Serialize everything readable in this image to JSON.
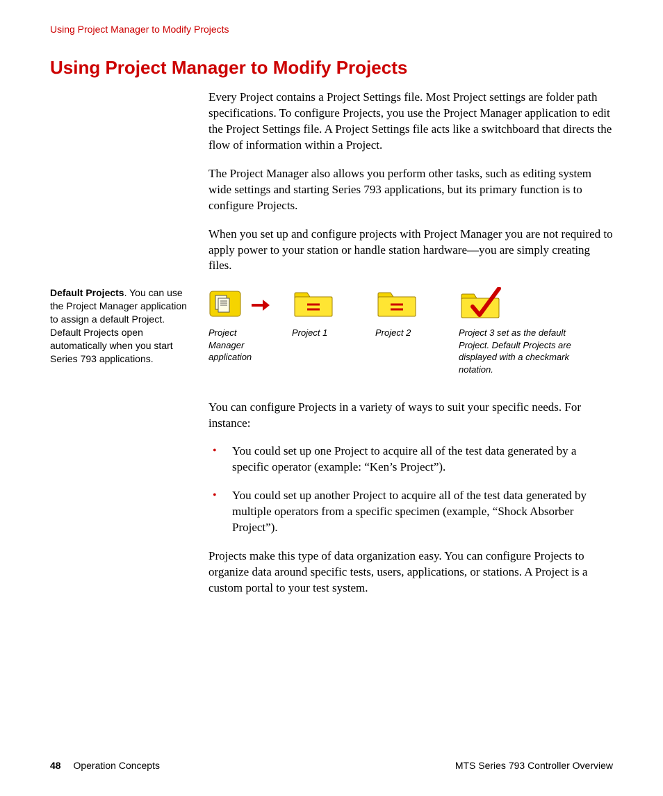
{
  "running_header": "Using Project Manager to Modify Projects",
  "heading": "Using Project Manager to Modify Projects",
  "intro": {
    "p1": "Every Project contains a Project Settings file. Most Project settings are folder path specifications. To configure Projects, you use the Project Manager application to edit the Project Settings file. A Project Settings file acts like a switchboard that directs the flow of information within a Project.",
    "p2": "The Project Manager also allows you perform other tasks, such as editing system wide settings and starting Series 793 applications, but its primary function is to configure Projects.",
    "p3": "When you set up and configure projects with Project Manager you are not required to apply power to your station or handle station hardware—you are simply creating files."
  },
  "side_note": {
    "title": "Default Projects",
    "body": ". You can use the Project Manager application to assign a default Project. Default Projects open automatically when you start Series 793 applications."
  },
  "figure": {
    "items": [
      {
        "caption": "Project Manager application"
      },
      {
        "caption": "Project 1"
      },
      {
        "caption": "Project 2"
      },
      {
        "caption": "Project 3 set as the default Project. Default Projects are displayed with a checkmark notation."
      }
    ]
  },
  "lead_in": "You can configure Projects in a variety of ways to suit your specific needs. For instance:",
  "bullets": [
    "You could set up one Project to acquire all of the test data generated by a specific operator (example: “Ken’s Project”).",
    "You could set up another Project to acquire all of the test data generated by multiple operators from a specific specimen (example, “Shock Absorber Project”)."
  ],
  "closing": "Projects make this type of data organization easy. You can configure Projects to organize data around specific tests, users, applications, or stations. A Project is a custom portal to your test system.",
  "footer": {
    "page_number": "48",
    "section": "Operation Concepts",
    "doc_title": "MTS Series 793 Controller Overview"
  }
}
